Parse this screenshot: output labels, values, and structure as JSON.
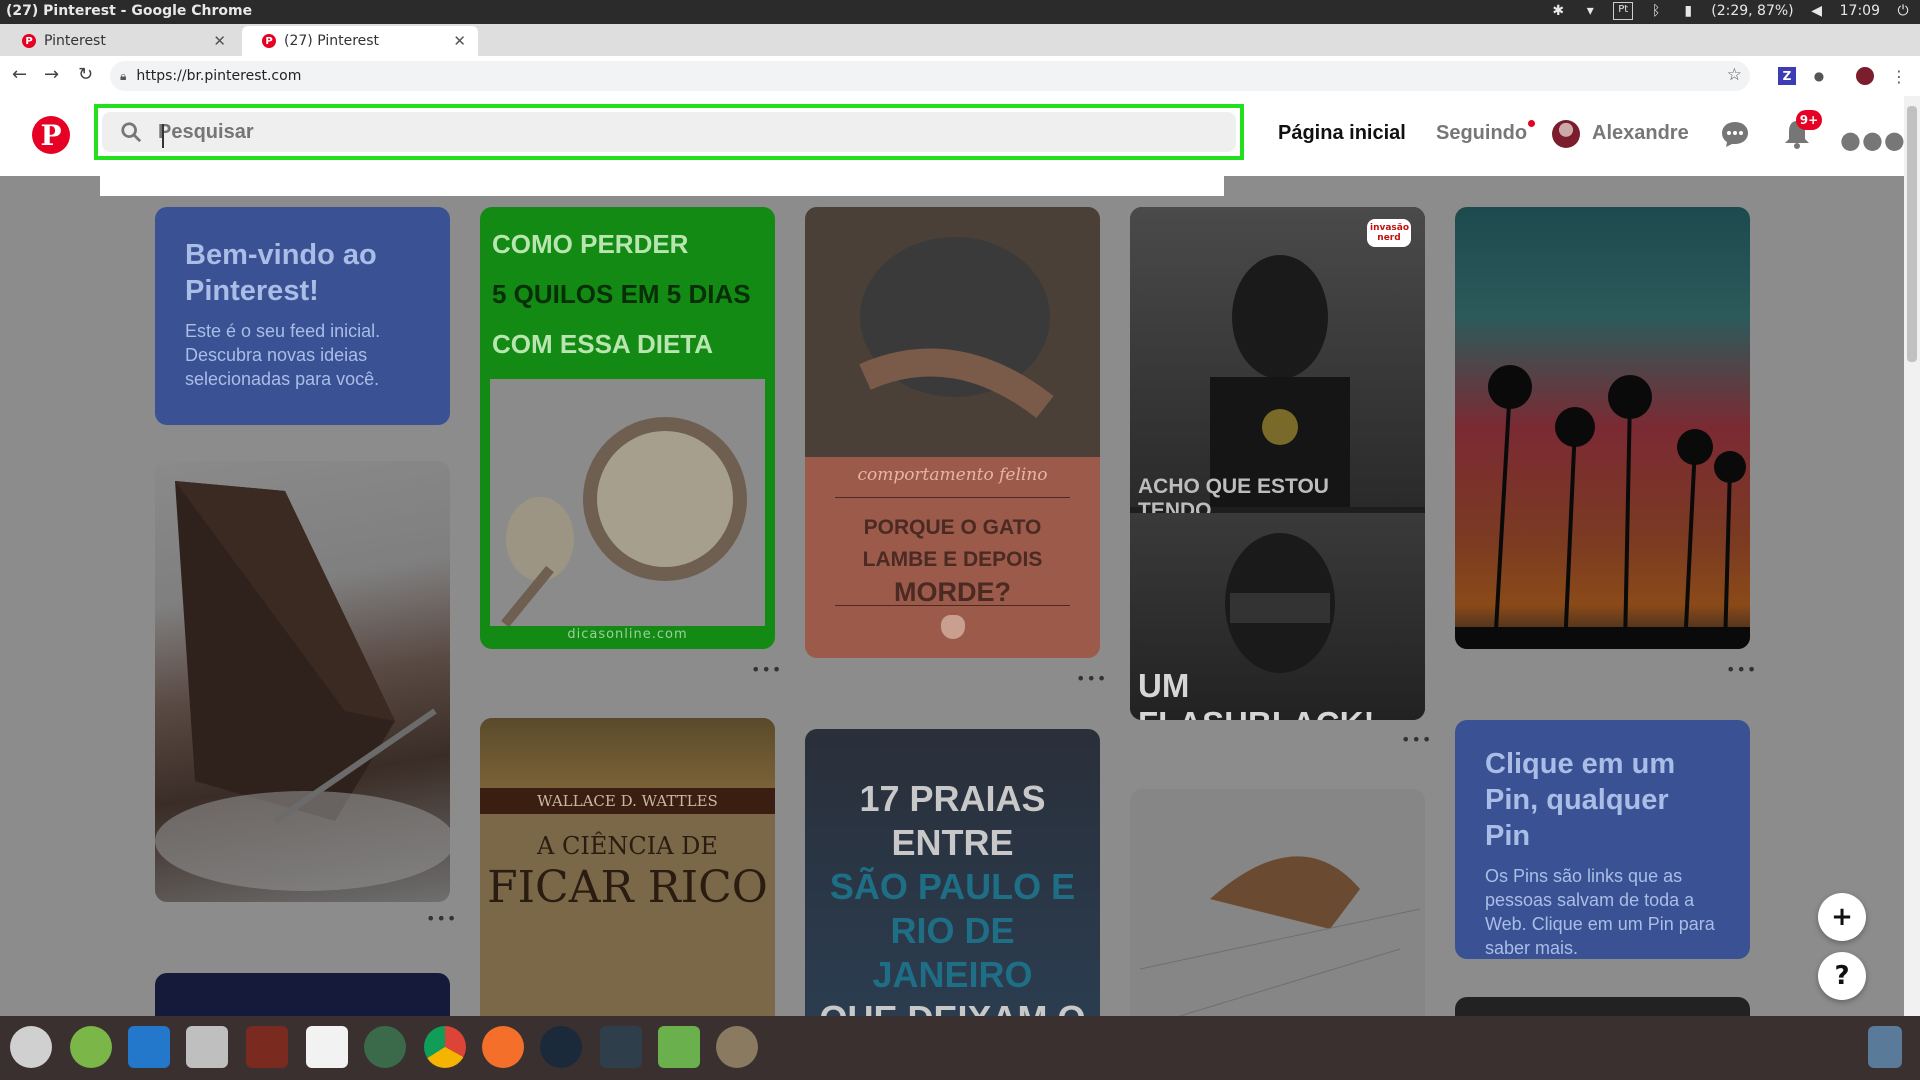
{
  "os": {
    "window_title": "(27) Pinterest - Google Chrome",
    "battery": "(2:29, 87%)",
    "clock": "17:09"
  },
  "browser": {
    "tabs": [
      {
        "label": "Pinterest"
      },
      {
        "label": "(27) Pinterest"
      }
    ],
    "url": "https://br.pinterest.com"
  },
  "pinterest": {
    "search_placeholder": "Pesquisar",
    "nav": {
      "home": "Página inicial",
      "following": "Seguindo",
      "user": "Alexandre",
      "notif_badge": "9+"
    },
    "cards": {
      "welcome_title": "Bem-vindo ao Pinterest!",
      "welcome_text": "Este é o seu feed inicial. Descubra novas ideias selecionadas para você.",
      "diet_line1": "COMO PERDER",
      "diet_line2": "5 QUILOS EM 5 DIAS",
      "diet_line3": "COM ESSA DIETA",
      "diet_source": "dicasonline.com",
      "cat_caption": "comportamento felino",
      "cat_title1": "PORQUE O GATO",
      "cat_title2": "LAMBE  E DEPOIS",
      "cat_title3": "MORDE?",
      "flash_top": "ACHO QUE ESTOU TENDO...",
      "flash_bottom": "UM FLASHBLACK!",
      "flash_logo": "invasão nerd",
      "book_author": "WALLACE D. WATTLES",
      "book_title1": "A CIÊNCIA DE",
      "book_title2": "FICAR RICO",
      "beach_line1": "17 PRAIAS",
      "beach_line2": "ENTRE",
      "beach_line3": "SÃO PAULO E",
      "beach_line4": "RIO DE",
      "beach_line5": "JANEIRO",
      "beach_line6": "QUE DEIXAM O",
      "click_title": "Clique em um Pin, qualquer Pin",
      "click_text": "Os Pins são links que as pessoas salvam de toda a Web. Clique em um Pin para saber mais.",
      "more": "•••"
    },
    "fab": {
      "add": "+",
      "help": "?"
    }
  },
  "colors": {
    "pinterest_red": "#e60023",
    "highlight_green": "#22e01e"
  }
}
